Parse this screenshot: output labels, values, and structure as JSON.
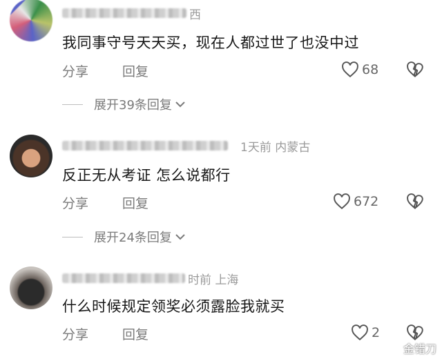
{
  "comments": [
    {
      "meta": "西",
      "text": "我同事守号天天买，现在人都过世了也没中过",
      "share_label": "分享",
      "reply_label": "回复",
      "likes": "68",
      "expand_label": "展开39条回复"
    },
    {
      "meta": "1天前 内蒙古",
      "text": "反正无从考证 怎么说都行",
      "share_label": "分享",
      "reply_label": "回复",
      "likes": "672",
      "expand_label": "展开24条回复"
    },
    {
      "meta": "时前 上海",
      "text": "什么时候规定领奖必须露脸我就买",
      "share_label": "分享",
      "reply_label": "回复",
      "likes": "2"
    }
  ],
  "watermark": {
    "text": "金错刀"
  },
  "colors": {
    "secondary_text": "#7a7a7a",
    "meta_text": "#9a9a9a",
    "primary_text": "#161616"
  },
  "icons": {
    "like": "heart-outline-icon",
    "dislike": "broken-heart-icon",
    "expand": "chevron-down-icon",
    "avatar": "blurred-avatar"
  }
}
